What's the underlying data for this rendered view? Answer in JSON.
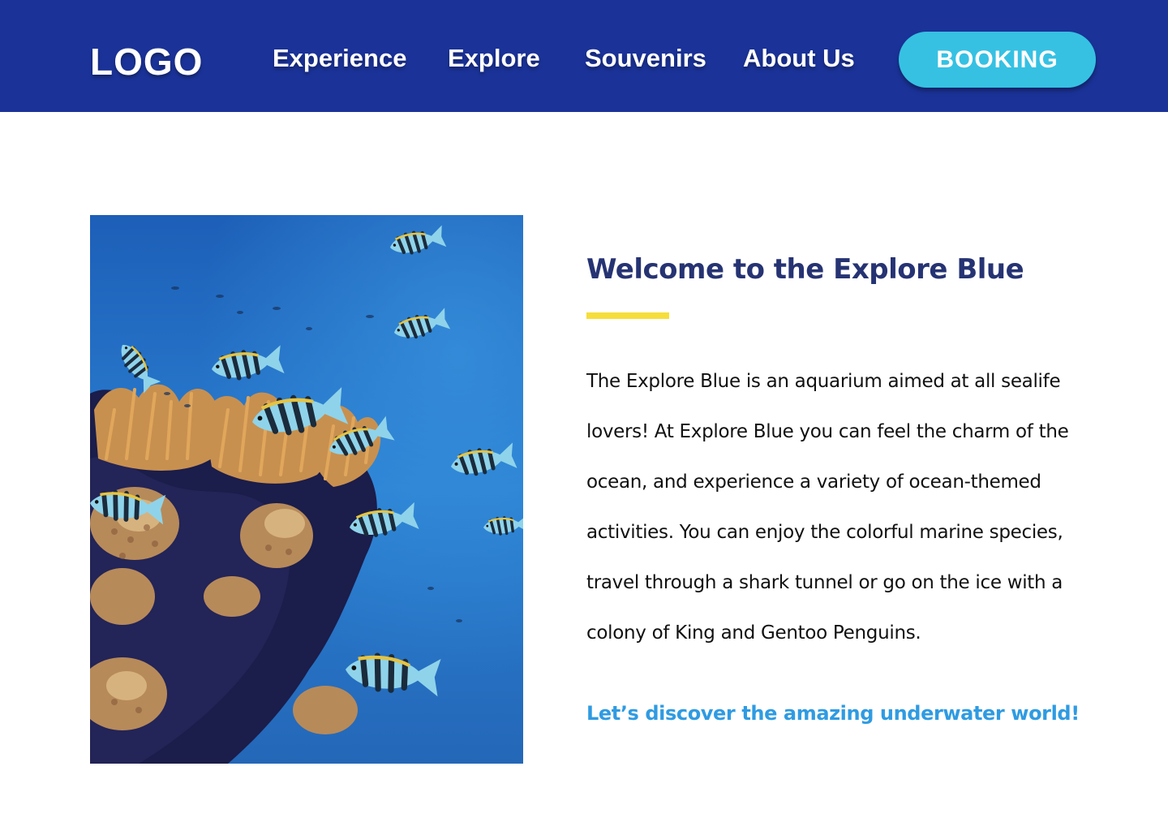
{
  "header": {
    "logo": "LOGO",
    "nav": [
      {
        "label": "Experience"
      },
      {
        "label": "Explore"
      },
      {
        "label": "Souvenirs"
      },
      {
        "label": "About Us"
      }
    ],
    "booking_label": "BOOKING"
  },
  "main": {
    "headline": "Welcome to the Explore Blue",
    "body": "The Explore Blue is an aquarium aimed at all sealife lovers! At Explore Blue you can feel the charm of the ocean, and experience a variety of ocean-themed activities. You can enjoy the colorful marine species, travel through a shark tunnel or go on the ice with a colony of King and Gentoo Penguins.",
    "cta": "Let’s discover the amazing underwater world!"
  },
  "colors": {
    "navbar": "#1b3399",
    "booking_button": "#36c1e3",
    "headline": "#263373",
    "accent_bar": "#f6de3a",
    "cta": "#2f9be2"
  },
  "image": {
    "subject": "coral-reef-with-striped-fish"
  }
}
